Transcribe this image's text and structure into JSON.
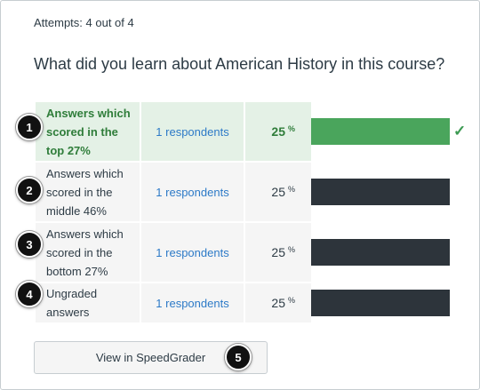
{
  "attempts_text": "Attempts: 4 out of 4",
  "question": "What did you learn about American History in this course?",
  "rows": [
    {
      "badge": "1",
      "label": "Answers which scored in the top 27%",
      "respondents": "1 respondents",
      "percent": "25",
      "percent_unit": "%",
      "bar_fraction": 1.0,
      "bar_color": "#4aa55c",
      "correct": true
    },
    {
      "badge": "2",
      "label": "Answers which scored in the middle 46%",
      "respondents": "1 respondents",
      "percent": "25",
      "percent_unit": "%",
      "bar_fraction": 1.0,
      "bar_color": "#2d343b",
      "correct": false
    },
    {
      "badge": "3",
      "label": "Answers which scored in the bottom 27%",
      "respondents": "1 respondents",
      "percent": "25",
      "percent_unit": "%",
      "bar_fraction": 1.0,
      "bar_color": "#2d343b",
      "correct": false
    },
    {
      "badge": "4",
      "label": "Ungraded answers",
      "respondents": "1 respondents",
      "percent": "25",
      "percent_unit": "%",
      "bar_fraction": 1.0,
      "bar_color": "#2d343b",
      "correct": false
    }
  ],
  "check_icon": "check-icon",
  "speedgrader_button": "View in SpeedGrader",
  "button_badge": "5"
}
